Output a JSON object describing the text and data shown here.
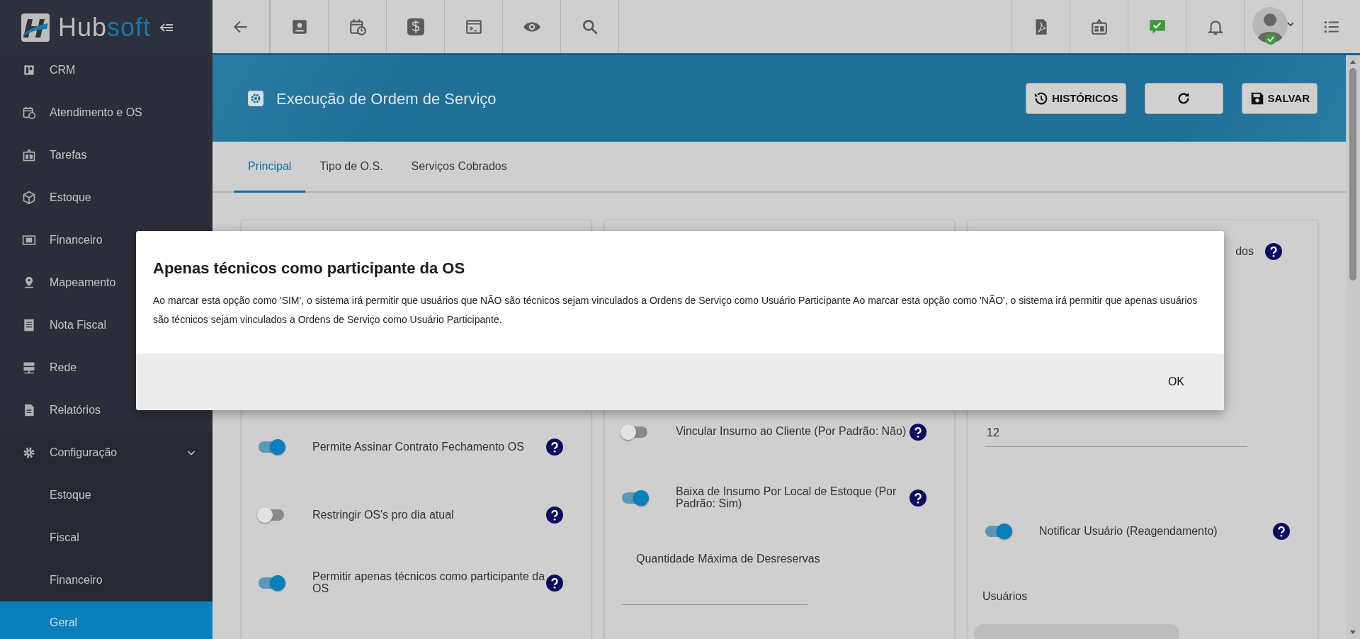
{
  "logo": {
    "first": "Hub",
    "second": "soft"
  },
  "sidebar": {
    "items": [
      {
        "label": "CRM",
        "selected": false
      },
      {
        "label": "Atendimento e OS",
        "selected": false
      },
      {
        "label": "Tarefas",
        "selected": false
      },
      {
        "label": "Estoque",
        "selected": false
      },
      {
        "label": "Financeiro",
        "selected": false
      },
      {
        "label": "Mapeamento",
        "selected": false
      },
      {
        "label": "Nota Fiscal",
        "selected": false
      },
      {
        "label": "Rede",
        "selected": false
      },
      {
        "label": "Relatórios",
        "selected": false
      },
      {
        "label": "Configuração",
        "selected": false,
        "expanded": true,
        "children": [
          {
            "label": "Estoque",
            "selected": false
          },
          {
            "label": "Fiscal",
            "selected": false
          },
          {
            "label": "Financeiro",
            "selected": false
          },
          {
            "label": "Geral",
            "selected": true
          }
        ]
      }
    ]
  },
  "page": {
    "title": "Execução de Ordem de Serviço",
    "buttons": [
      {
        "kind": "history",
        "label": "HISTÓRICOS"
      },
      {
        "kind": "refresh"
      },
      {
        "kind": "save",
        "label": "SALVAR"
      }
    ]
  },
  "tabs": [
    {
      "label": "Principal",
      "selected": true
    },
    {
      "label": "Tipo de O.S.",
      "selected": false
    },
    {
      "label": "Serviços Cobrados",
      "selected": false
    }
  ],
  "columns": [
    {
      "items": [
        {
          "kind": "toggle",
          "label": "Permite Assinar Contrato Fechamento OS",
          "on": true
        },
        {
          "kind": "toggle",
          "label": "Restringir OS's pro dia atual",
          "on": false
        },
        {
          "kind": "toggle",
          "label": "Permitir apenas técnicos como participante da OS",
          "on": true
        }
      ]
    },
    {
      "items": [
        {
          "kind": "toggle",
          "label": "Vincular Insumo ao Cliente (Por Padrão: Não)",
          "on": false
        },
        {
          "kind": "toggle",
          "label": "Baixa de Insumo Por Local de Estoque (Por Padrão: Sim)",
          "on": true
        },
        {
          "kind": "field",
          "label": "Quantidade Máxima de Desreservas"
        }
      ]
    },
    {
      "items": [
        {
          "kind": "help_text",
          "label": "dos"
        },
        {
          "kind": "field",
          "value": "12"
        },
        {
          "kind": "toggle",
          "label": "Notificar Usuário (Reagendamento)",
          "on": true
        },
        {
          "kind": "caption",
          "label": "Usuários"
        },
        {
          "kind": "select"
        }
      ]
    }
  ],
  "dialog": {
    "title": "Apenas técnicos como participante da OS",
    "text": "Ao marcar esta opção como 'SIM', o sistema irá permitir que usuários que NÃO são técnicos sejam vinculados a Ordens de Serviço como Usuário Participante Ao marcar esta opção como 'NÃO', o sistema irá permitir que apenas usuários são técnicos sejam vinculados a Ordens de Serviço como Usuário Participante.",
    "button": "OK"
  }
}
